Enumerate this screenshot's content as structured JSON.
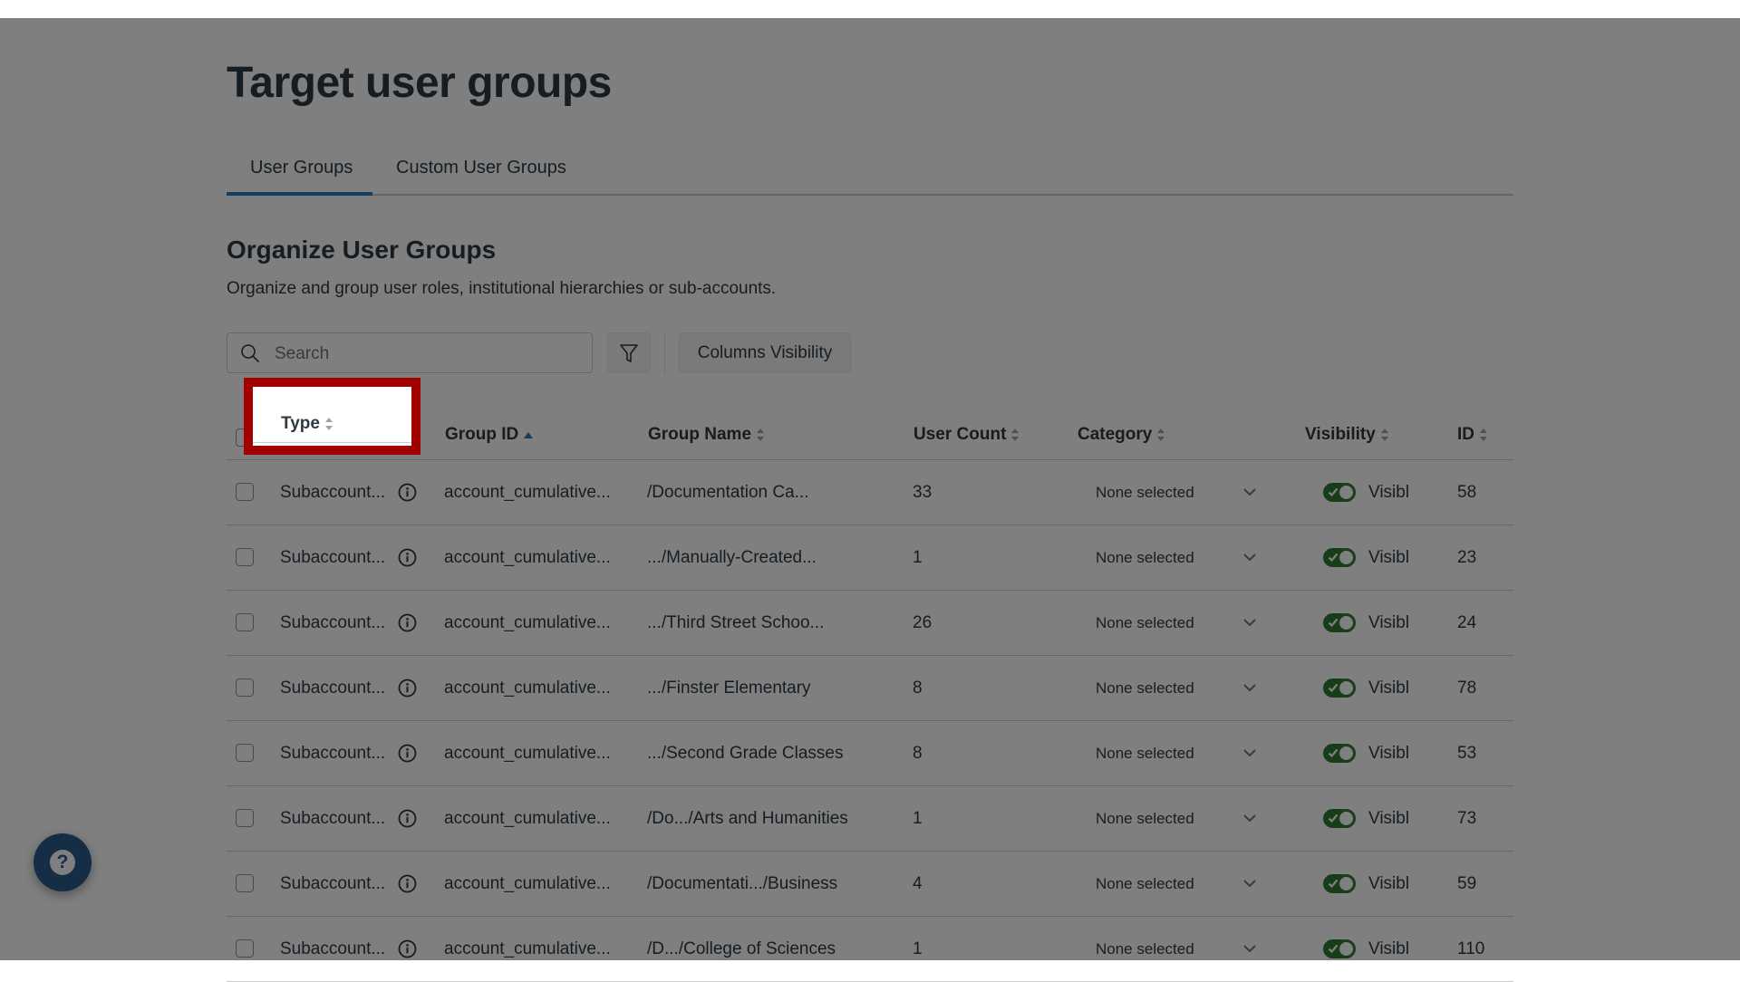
{
  "page": {
    "title": "Target user groups",
    "tabs": [
      {
        "label": "User Groups",
        "active": true
      },
      {
        "label": "Custom User Groups",
        "active": false
      }
    ],
    "section_title": "Organize User Groups",
    "section_description": "Organize and group user roles, institutional hierarchies or sub-accounts."
  },
  "toolbar": {
    "search_placeholder": "Search",
    "search_value": "",
    "filter_icon": "filter-icon",
    "columns_visibility_label": "Columns Visibility"
  },
  "table": {
    "columns": [
      {
        "key": "type",
        "label": "Type",
        "sort": "none"
      },
      {
        "key": "group_id",
        "label": "Group ID",
        "sort": "ascending"
      },
      {
        "key": "group_name",
        "label": "Group Name",
        "sort": "none"
      },
      {
        "key": "user_count",
        "label": "User Count",
        "sort": "none"
      },
      {
        "key": "category",
        "label": "Category",
        "sort": "none"
      },
      {
        "key": "visibility",
        "label": "Visibility",
        "sort": "none"
      },
      {
        "key": "id",
        "label": "ID",
        "sort": "none"
      }
    ],
    "rows": [
      {
        "type": "Subaccount...",
        "group_id": "account_cumulative...",
        "group_name": "/Documentation Ca...",
        "user_count": "33",
        "category": "None selected",
        "visibility": "Visibl",
        "visible": true,
        "id": "58"
      },
      {
        "type": "Subaccount...",
        "group_id": "account_cumulative...",
        "group_name": ".../Manually-Created...",
        "user_count": "1",
        "category": "None selected",
        "visibility": "Visibl",
        "visible": true,
        "id": "23"
      },
      {
        "type": "Subaccount...",
        "group_id": "account_cumulative...",
        "group_name": ".../Third Street Schoo...",
        "user_count": "26",
        "category": "None selected",
        "visibility": "Visibl",
        "visible": true,
        "id": "24"
      },
      {
        "type": "Subaccount...",
        "group_id": "account_cumulative...",
        "group_name": ".../Finster Elementary",
        "user_count": "8",
        "category": "None selected",
        "visibility": "Visibl",
        "visible": true,
        "id": "78"
      },
      {
        "type": "Subaccount...",
        "group_id": "account_cumulative...",
        "group_name": ".../Second Grade Classes",
        "user_count": "8",
        "category": "None selected",
        "visibility": "Visibl",
        "visible": true,
        "id": "53"
      },
      {
        "type": "Subaccount...",
        "group_id": "account_cumulative...",
        "group_name": "/Do.../Arts and Humanities",
        "user_count": "1",
        "category": "None selected",
        "visibility": "Visibl",
        "visible": true,
        "id": "73"
      },
      {
        "type": "Subaccount...",
        "group_id": "account_cumulative...",
        "group_name": "/Documentati.../Business",
        "user_count": "4",
        "category": "None selected",
        "visibility": "Visibl",
        "visible": true,
        "id": "59"
      },
      {
        "type": "Subaccount...",
        "group_id": "account_cumulative...",
        "group_name": "/D.../College of Sciences",
        "user_count": "1",
        "category": "None selected",
        "visibility": "Visibl",
        "visible": true,
        "id": "110"
      }
    ]
  },
  "highlight": {
    "target": "Type column header",
    "color": "#a30000"
  },
  "help_button": {
    "icon": "question-icon",
    "label": "?"
  },
  "colors": {
    "accent": "#2b7abc",
    "toggle_on": "#2e7d32",
    "help": "#2a5a8a",
    "highlight": "#a30000"
  }
}
